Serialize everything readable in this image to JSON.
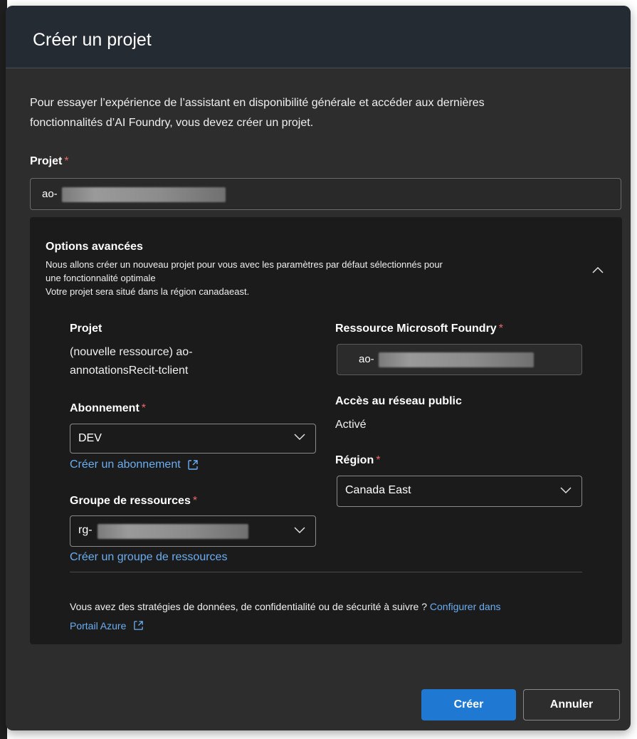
{
  "dialog": {
    "title": "Créer un projet",
    "intro_line1": "Pour essayer l’expérience de l’assistant en disponibilité générale et accéder aux dernières",
    "intro_line2": "fonctionnalités d’AI Foundry, vous devez créer un projet.",
    "project_field": {
      "label": "Projet",
      "required_mark": "*",
      "value": "ao-"
    },
    "advanced": {
      "title": "Options avancées",
      "description_line1": "Nous allons créer un nouveau projet pour vous avec les paramètres par défaut sélectionnés pour",
      "description_line2": "une fonctionnalité optimale",
      "description_line3": "Votre projet sera situé dans la région canadaeast.",
      "collapse_icon": "chevron-up-icon",
      "project": {
        "label": "Projet",
        "value_line1": "(nouvelle ressource) ao-",
        "value_line2": "annotationsRecit-tclient"
      },
      "subscription": {
        "label": "Abonnement",
        "required_mark": "*",
        "value": "DEV",
        "create_link": "Créer un abonnement"
      },
      "resource_group": {
        "label": "Groupe de ressources",
        "required_mark": "*",
        "value": "rg-",
        "create_link": "Créer un groupe de ressources"
      },
      "foundry_resource": {
        "label": "Ressource Microsoft Foundry",
        "required_mark": "*",
        "value": "ao-"
      },
      "public_network": {
        "label": "Accès au réseau public",
        "value": "Activé"
      },
      "region": {
        "label": "Région",
        "required_mark": "*",
        "value": "Canada East"
      },
      "footnote_text": "Vous avez des stratégies de données, de confidentialité ou de sécurité à suivre ?",
      "footnote_link_line1": "Configurer dans",
      "footnote_link_line2": "Portail Azure"
    },
    "buttons": {
      "create": "Créer",
      "cancel": "Annuler"
    }
  },
  "colors": {
    "dialog_bg": "#2d2d2d",
    "header_bg": "#242b33",
    "panel_bg": "#1b1b1b",
    "link": "#6aaef2",
    "required": "#e8676a",
    "primary_button": "#1f78d1"
  }
}
